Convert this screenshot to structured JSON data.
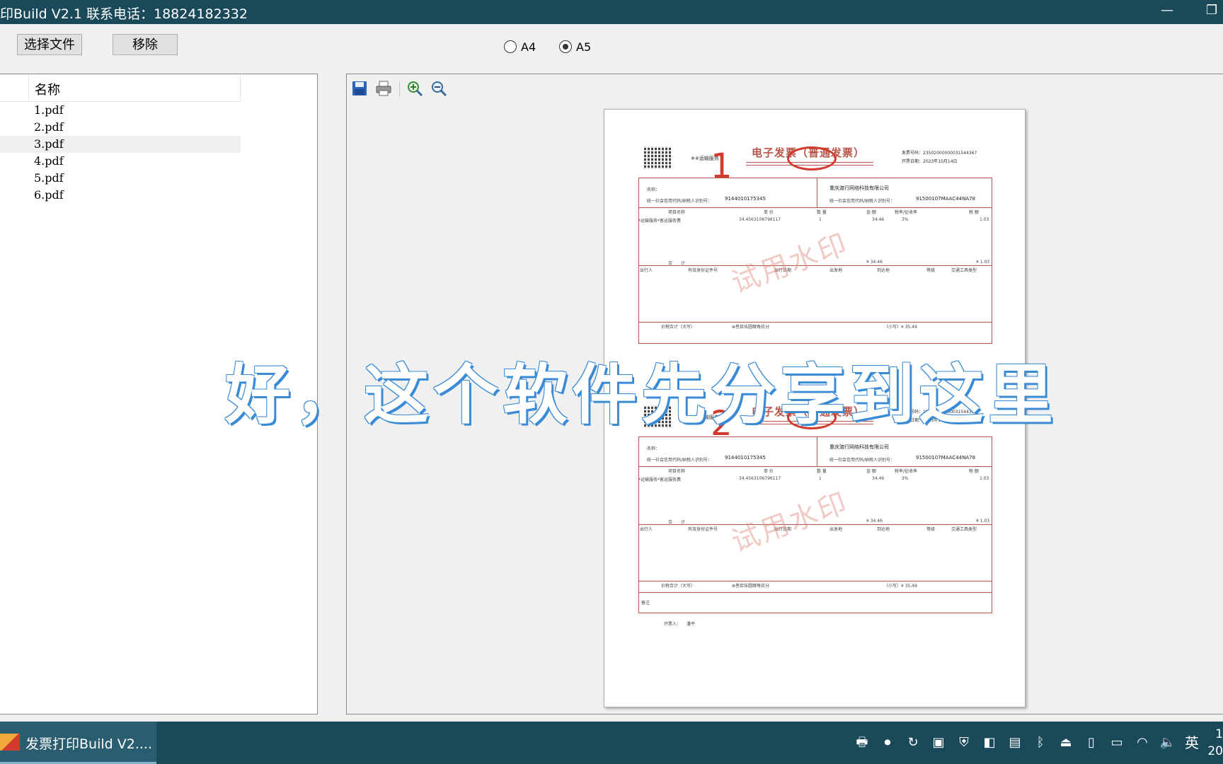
{
  "window": {
    "title": "印Build V2.1  联系电话：18824182332",
    "minimize_glyph": "—",
    "restore_glyph": "❐"
  },
  "toolbar": {
    "select_file_label": "选择文件",
    "remove_label": "移除",
    "radio_a4_label": "A4",
    "radio_a5_label": "A5",
    "selected_size": "A5"
  },
  "file_list": {
    "column_header": "名称",
    "items": [
      "1.pdf",
      "2.pdf",
      "3.pdf",
      "4.pdf",
      "5.pdf",
      "6.pdf"
    ],
    "selected_index": 2
  },
  "preview_toolbar": {
    "icons": [
      "save-icon",
      "print-icon",
      "zoom-in-icon",
      "zoom-out-icon"
    ]
  },
  "invoice": {
    "title": "电子发票（普通发票）",
    "company_type": "※※运输服务",
    "invoice_no_label": "发票号码：",
    "invoice_no": "23502000000031544367",
    "date_label": "开票日期：",
    "date": "2023年10月14日",
    "buyer_label": "名称：",
    "tax_id_label": "统一社会信用代码/纳税人识别号：",
    "buyer_tax_id": "9144010175345",
    "seller_name": "重庆渡行网络科技有限公司",
    "seller_tax_id": "91500107MAAC44NA78",
    "col_item": "项目名称",
    "col_price": "单 价",
    "col_qty": "数 量",
    "col_amount": "金 额",
    "col_rate": "税率/征收率",
    "col_tax": "税 额",
    "item_name": "*运输服务*客运服务费",
    "item_price": "34.4563106796117",
    "item_qty": "1",
    "item_amount": "34.46",
    "item_rate": "3%",
    "item_tax": "1.03",
    "total_label": "合　　计",
    "total_amount": "¥ 34.46",
    "total_tax": "¥ 1.03",
    "route_cols": [
      "出行人",
      "有效身份证件号",
      "出行日期",
      "出发地",
      "到达地",
      "等级",
      "交通工具类型"
    ],
    "total_cn_label": "价税合计（大写）",
    "total_cn": "⊗叁拾伍圆肆角玖分",
    "total_small": "（小写）¥ 35.49",
    "remark_label": "备注",
    "issuer_label": "开票人：",
    "issuer": "潘平",
    "watermark": "试用水印",
    "handwrite_1": "1",
    "handwrite_2": "2"
  },
  "subtitle": "好，这个软件先分享到这里",
  "taskbar": {
    "app_label": "发票打印Build V2....",
    "ime_label": "英",
    "clock_top": "1",
    "clock_bottom": "20"
  }
}
